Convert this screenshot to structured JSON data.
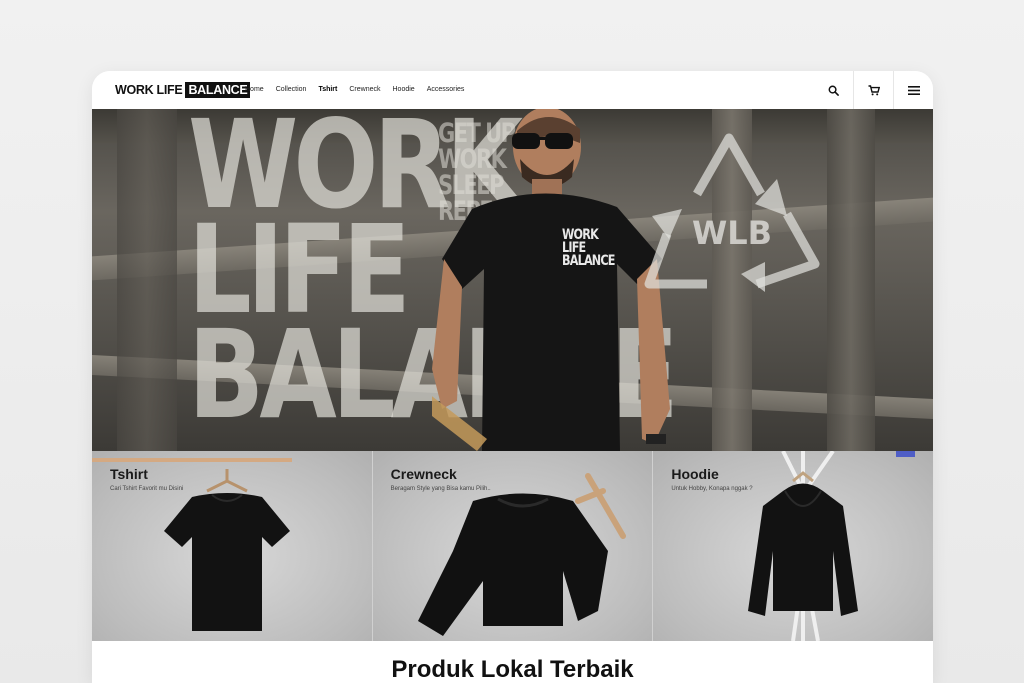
{
  "brand": {
    "logo_plain": "WORK LIFE",
    "logo_boxed": "BALANCE"
  },
  "nav": {
    "items": [
      {
        "label": "Home"
      },
      {
        "label": "Collection"
      },
      {
        "label": "Tshirt"
      },
      {
        "label": "Crewneck"
      },
      {
        "label": "Hoodie"
      },
      {
        "label": "Accessories"
      }
    ],
    "icons": [
      "search-icon",
      "cart-icon",
      "hamburger-menu-icon"
    ]
  },
  "hero": {
    "big_text": [
      "WORK",
      "LIFE",
      "BALANCE"
    ],
    "side_text": [
      "GET UP",
      "WORK",
      "SLEEP",
      "REPEAT"
    ],
    "shirt_print": [
      "WORK",
      "LIFE",
      "BALANCE"
    ],
    "badge": "WLB"
  },
  "categories": [
    {
      "title": "Tshirt",
      "subtitle": "Cari Tshirt Favorit mu Disini"
    },
    {
      "title": "Crewneck",
      "subtitle": "Beragam Style yang Bisa kamu Pilih.."
    },
    {
      "title": "Hoodie",
      "subtitle": "Untuk Hobby, Konapa nggak ?"
    }
  ],
  "section_title": "Produk Lokal Terbaik",
  "colors": {
    "accent": "#4f5ec6",
    "text": "#111111"
  }
}
